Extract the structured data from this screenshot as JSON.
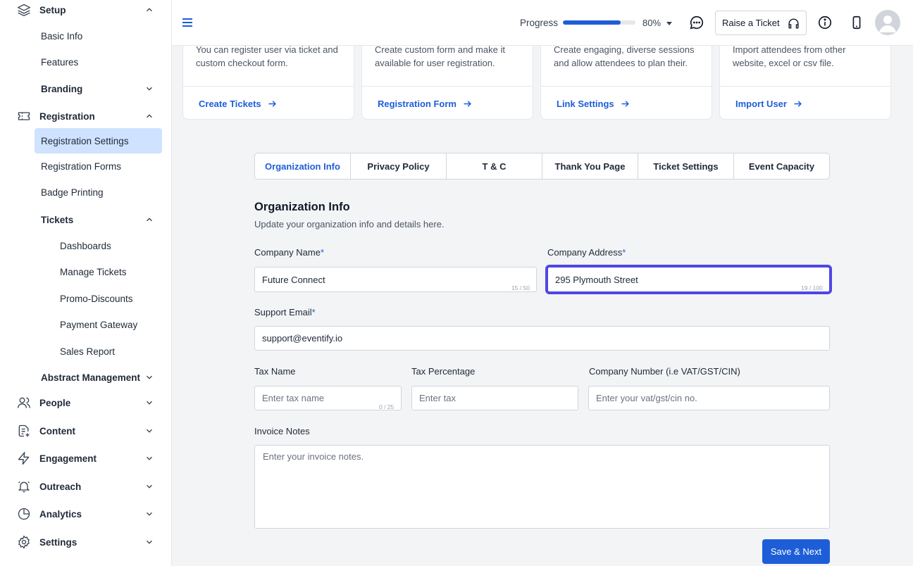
{
  "sidebar": {
    "setup": "Setup",
    "basic_info": "Basic Info",
    "features": "Features",
    "branding": "Branding",
    "registration": "Registration",
    "registration_settings": "Registration Settings",
    "registration_forms": "Registration Forms",
    "badge_printing": "Badge Printing",
    "tickets": "Tickets",
    "dashboards": "Dashboards",
    "manage_tickets": "Manage Tickets",
    "promo_discounts": "Promo-Discounts",
    "payment_gateway": "Payment Gateway",
    "sales_report": "Sales Report",
    "abstract_management": "Abstract Management",
    "people": "People",
    "content": "Content",
    "engagement": "Engagement",
    "outreach": "Outreach",
    "analytics": "Analytics",
    "settings": "Settings"
  },
  "header": {
    "progress_label": "Progress",
    "progress_value": 0.8,
    "progress_text": "80%",
    "raise_ticket": "Raise a Ticket"
  },
  "cards": [
    {
      "desc": "You can register user via ticket and custom checkout form.",
      "link": "Create Tickets"
    },
    {
      "desc": "Create custom form and make it available for user registration.",
      "link": "Registration Form"
    },
    {
      "desc": "Create engaging, diverse sessions and allow attendees to plan their.",
      "link": "Link Settings"
    },
    {
      "desc": "Import attendees from other website, excel or csv file.",
      "link": "Import User"
    }
  ],
  "tabs": [
    "Organization Info",
    "Privacy Policy",
    "T & C",
    "Thank You Page",
    "Ticket Settings",
    "Event Capacity"
  ],
  "form": {
    "title": "Organization Info",
    "subtitle": "Update your organization info and details here.",
    "company_name_label": "Company Name",
    "company_name_value": "Future Connect",
    "company_name_count": "15 / 50",
    "company_address_label": "Company Address",
    "company_address_value": "295 Plymouth Street",
    "company_address_count": "19 / 100",
    "support_email_label": "Support Email",
    "support_email_value": "support@eventify.io",
    "tax_name_label": "Tax Name",
    "tax_name_placeholder": "Enter tax name",
    "tax_name_count": "0 / 25",
    "tax_percentage_label": "Tax Percentage",
    "tax_percentage_placeholder": "Enter tax",
    "company_number_label": "Company Number (i.e VAT/GST/CIN)",
    "company_number_placeholder": "Enter your vat/gst/cin no.",
    "invoice_notes_label": "Invoice Notes",
    "invoice_notes_placeholder": "Enter your invoice notes.",
    "required_mark": "*",
    "save_label": "Save & Next"
  },
  "colors": {
    "accent": "#1d5ed8",
    "active_bg": "#cfe2ff",
    "focus": "#4f46e5"
  }
}
